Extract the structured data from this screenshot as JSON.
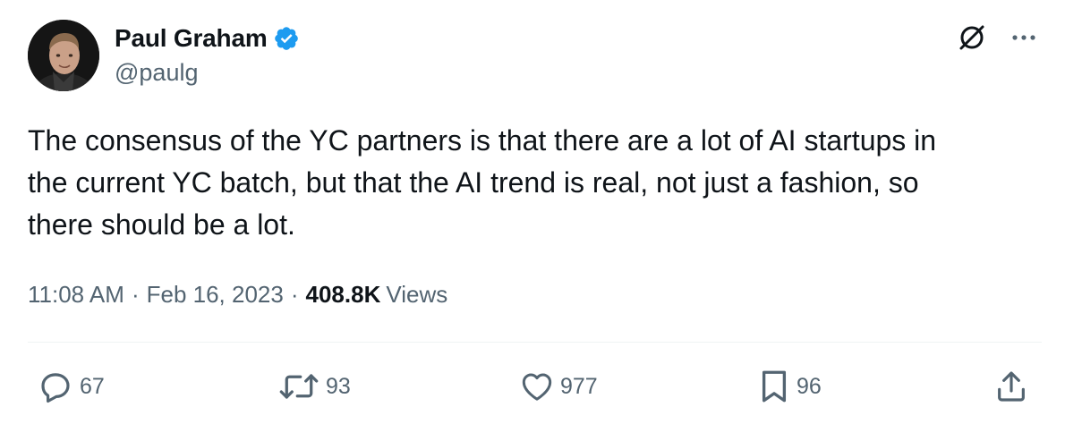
{
  "author": {
    "name": "Paul Graham",
    "handle": "@paulg",
    "verified": true
  },
  "tweet": {
    "text": "The consensus of the YC partners is that there are a lot of AI startups in\nthe current YC batch, but that the AI trend is real, not just a fashion, so\nthere should be a lot.",
    "time": "11:08 AM",
    "separator": "·",
    "date": "Feb 16, 2023",
    "views_count": "408.8K",
    "views_label": "Views"
  },
  "actions": {
    "replies": "67",
    "retweets": "93",
    "likes": "977",
    "bookmarks": "96"
  },
  "icons": {
    "header": [
      "grok-icon",
      "more-icon"
    ],
    "footer": [
      "reply-icon",
      "retweet-icon",
      "like-icon",
      "bookmark-icon",
      "share-icon"
    ]
  },
  "colors": {
    "text_primary": "#0f1419",
    "text_secondary": "#536471",
    "verified_blue": "#1d9bf0",
    "divider": "#eff3f4"
  }
}
